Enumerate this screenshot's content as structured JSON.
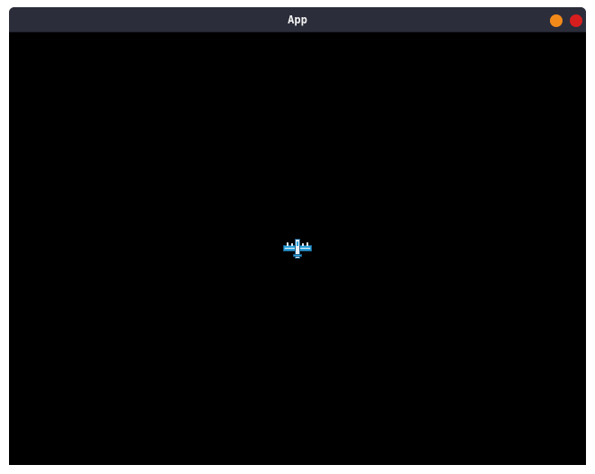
{
  "window": {
    "title": "App"
  },
  "controls": {
    "minimize": {
      "icon": "circle-icon",
      "color": "#f28a1a"
    },
    "close": {
      "icon": "circle-icon",
      "color": "#d71e1e"
    }
  },
  "game": {
    "background_color": "#000000",
    "player_ship": {
      "icon": "spaceship-icon",
      "colors": [
        "#2aa3dc",
        "#e8eef4",
        "#1b5f8a"
      ]
    }
  }
}
